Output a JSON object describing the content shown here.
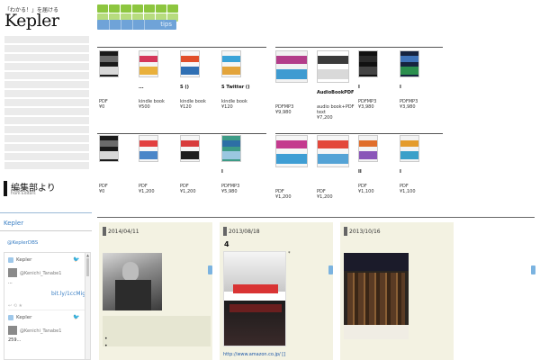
{
  "site": {
    "tagline": "「わかる！」を届ける",
    "logo": "Kepler"
  },
  "editors": {
    "title_jp": "編集部より",
    "title_en": "from Editors"
  },
  "twitter": {
    "title": "Kepler",
    "handle": "@KeplerDBS",
    "tweets": [
      {
        "account": "Kepler",
        "user": "@Kenichi_Tanabe1",
        "text": "...",
        "link": "bit.ly/1ccMig3"
      },
      {
        "account": "Kepler",
        "user": "@Kenichi_Tanabe1",
        "text": "259...",
        "link": ""
      }
    ]
  },
  "tabs": {
    "tips_label": "tips"
  },
  "shelf_rows": [
    {
      "books": [
        {
          "title": "",
          "type": "PDF",
          "price": "¥0",
          "colors": [
            "#1a1a1a",
            "#6b6b6b",
            "#d8d8d8"
          ]
        },
        {
          "title": "...",
          "type": "kindle book",
          "price": "¥500",
          "colors": [
            "#f4f4f4",
            "#d5375a",
            "#e9b03b"
          ]
        },
        {
          "title": "S ()",
          "type": "kindle book",
          "price": "¥120",
          "colors": [
            "#f7f7f7",
            "#e14f2a",
            "#2f6fb3"
          ]
        },
        {
          "title": "S Twitter ()",
          "type": "kindle book",
          "price": "¥120",
          "colors": [
            "#f5f5f5",
            "#3aa3d8",
            "#e3a43b"
          ]
        },
        {
          "title": "",
          "type": "PDFMP3",
          "price": "¥9,980",
          "colors": [
            "#f2f2f2",
            "#b33d8a",
            "#3e9bd1"
          ]
        },
        {
          "title": "AudioBookPDF",
          "type": "audio book+PDF text",
          "price": "¥7,200",
          "colors": [
            "#ffffff",
            "#3b3b3b",
            "#d9d9d9"
          ]
        },
        {
          "title": "I",
          "type": "PDFMP3",
          "price": "¥3,980",
          "colors": [
            "#111111",
            "#2a2a2a",
            "#444444"
          ]
        },
        {
          "title": "I",
          "type": "PDFMP3",
          "price": "¥3,980",
          "colors": [
            "#16243f",
            "#3f73b8",
            "#2b8f4e"
          ]
        }
      ]
    },
    {
      "books": [
        {
          "title": "",
          "type": "PDF",
          "price": "¥0",
          "colors": [
            "#1a1a1a",
            "#6b6b6b",
            "#d8d8d8"
          ]
        },
        {
          "title": "",
          "type": "PDF",
          "price": "¥1,200",
          "colors": [
            "#f6f6f6",
            "#e23f3f",
            "#4b86c8"
          ]
        },
        {
          "title": "",
          "type": "PDF",
          "price": "¥1,200",
          "colors": [
            "#f6f6f6",
            "#d83b3b",
            "#1f1f1f"
          ]
        },
        {
          "title": "I",
          "type": "PDFMP3",
          "price": "¥5,980",
          "colors": [
            "#3d9b86",
            "#2d6fa5",
            "#9ac7e0"
          ]
        },
        {
          "title": "",
          "type": "PDF",
          "price": "¥1,200",
          "colors": [
            "#f6f6f6",
            "#c43a8e",
            "#3f9ed4"
          ]
        },
        {
          "title": "",
          "type": "PDF",
          "price": "¥1,200",
          "colors": [
            "#f6f6f6",
            "#e3483b",
            "#54a3d6"
          ]
        },
        {
          "title": "II",
          "type": "PDF",
          "price": "¥1,100",
          "colors": [
            "#f3f3f3",
            "#e06d2a",
            "#8a56b8"
          ]
        },
        {
          "title": "I",
          "type": "PDF",
          "price": "¥1,100",
          "colors": [
            "#f3f3f3",
            "#e49b2b",
            "#3aa0c9"
          ]
        }
      ]
    }
  ],
  "columns": [
    {
      "date": "2014/04/11",
      "num": "",
      "note": "",
      "bullets": [
        "•",
        "•"
      ]
    },
    {
      "date": "2013/08/18",
      "num": "4",
      "note": "*",
      "link": "http://www.amazon.co.jp/ []"
    },
    {
      "date": "2013/10/16",
      "num": "",
      "note": ""
    }
  ],
  "colors": {
    "accent_green": "#8dc63f",
    "accent_blue": "#6fa3d8",
    "panel_bg": "#f3f2e2"
  }
}
